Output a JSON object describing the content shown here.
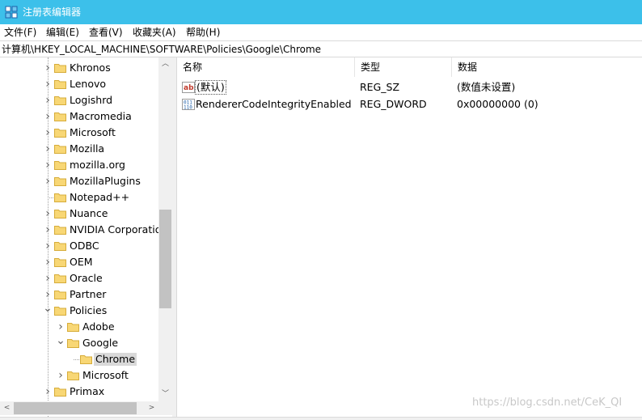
{
  "window": {
    "title": "注册表编辑器"
  },
  "menu": [
    "文件(F)",
    "编辑(E)",
    "查看(V)",
    "收藏夹(A)",
    "帮助(H)"
  ],
  "address": "计算机\\HKEY_LOCAL_MACHINE\\SOFTWARE\\Policies\\Google\\Chrome",
  "tree": [
    {
      "label": "Khronos",
      "level": 0,
      "state": "collapsed"
    },
    {
      "label": "Lenovo",
      "level": 0,
      "state": "collapsed"
    },
    {
      "label": "Logishrd",
      "level": 0,
      "state": "collapsed"
    },
    {
      "label": "Macromedia",
      "level": 0,
      "state": "collapsed"
    },
    {
      "label": "Microsoft",
      "level": 0,
      "state": "collapsed"
    },
    {
      "label": "Mozilla",
      "level": 0,
      "state": "collapsed"
    },
    {
      "label": "mozilla.org",
      "level": 0,
      "state": "collapsed"
    },
    {
      "label": "MozillaPlugins",
      "level": 0,
      "state": "collapsed"
    },
    {
      "label": "Notepad++",
      "level": 0,
      "state": "leaf"
    },
    {
      "label": "Nuance",
      "level": 0,
      "state": "collapsed"
    },
    {
      "label": "NVIDIA Corporation",
      "level": 0,
      "state": "collapsed"
    },
    {
      "label": "ODBC",
      "level": 0,
      "state": "collapsed"
    },
    {
      "label": "OEM",
      "level": 0,
      "state": "collapsed"
    },
    {
      "label": "Oracle",
      "level": 0,
      "state": "collapsed"
    },
    {
      "label": "Partner",
      "level": 0,
      "state": "collapsed"
    },
    {
      "label": "Policies",
      "level": 0,
      "state": "expanded"
    },
    {
      "label": "Adobe",
      "level": 1,
      "state": "collapsed"
    },
    {
      "label": "Google",
      "level": 1,
      "state": "expanded"
    },
    {
      "label": "Chrome",
      "level": 2,
      "state": "leaf",
      "selected": true
    },
    {
      "label": "Microsoft",
      "level": 1,
      "state": "collapsed"
    },
    {
      "label": "Primax",
      "level": 0,
      "state": "collapsed"
    }
  ],
  "columns": {
    "name": "名称",
    "type": "类型",
    "data": "数据"
  },
  "values": [
    {
      "icon": "string-value-icon",
      "name": "(默认)",
      "type": "REG_SZ",
      "data": "(数值未设置)"
    },
    {
      "icon": "binary-value-icon",
      "name": "RendererCodeIntegrityEnabled",
      "type": "REG_DWORD",
      "data": "0x00000000 (0)"
    }
  ],
  "watermark": "https://blog.csdn.net/CeK_QI",
  "colors": {
    "titlebar": "#3cc0ea",
    "folder": "#f8d775",
    "selection": "#d9d9d9"
  }
}
